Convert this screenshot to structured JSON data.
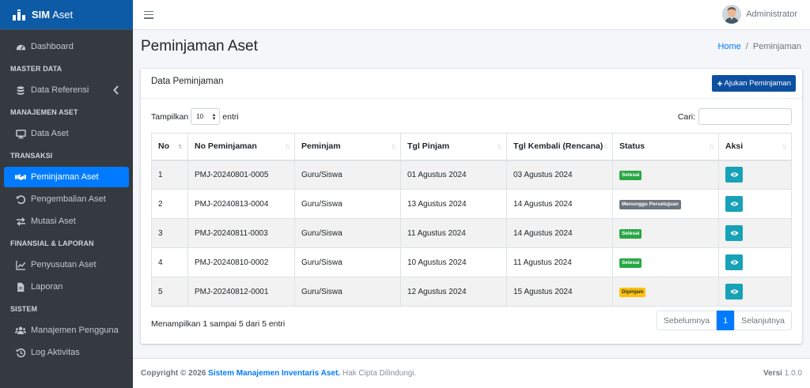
{
  "brand": {
    "name_bold": "SIM",
    "name_light": "Aset"
  },
  "topbar": {
    "user_name": "Administrator"
  },
  "sidebar": {
    "items": [
      {
        "type": "item",
        "label": "Dashboard",
        "icon": "dashboard-icon"
      },
      {
        "type": "header",
        "label": "MASTER DATA"
      },
      {
        "type": "item",
        "label": "Data Referensi",
        "icon": "database-icon"
      },
      {
        "type": "header",
        "label": "MANAJEMEN ASET"
      },
      {
        "type": "item",
        "label": "Data Aset",
        "icon": "desktop-icon"
      },
      {
        "type": "header",
        "label": "TRANSAKSI"
      },
      {
        "type": "item",
        "label": "Peminjaman Aset",
        "icon": "handshake-icon",
        "active": true
      },
      {
        "type": "item",
        "label": "Pengembalian Aset",
        "icon": "undo-icon"
      },
      {
        "type": "item",
        "label": "Mutasi Aset",
        "icon": "exchange-icon"
      },
      {
        "type": "header",
        "label": "FINANSIAL & LAPORAN"
      },
      {
        "type": "item",
        "label": "Penyusutan Aset",
        "icon": "chart-line-icon"
      },
      {
        "type": "item",
        "label": "Laporan",
        "icon": "file-icon"
      },
      {
        "type": "header",
        "label": "SISTEM"
      },
      {
        "type": "item",
        "label": "Manajemen Pengguna",
        "icon": "users-icon"
      },
      {
        "type": "item",
        "label": "Log Aktivitas",
        "icon": "history-icon"
      }
    ]
  },
  "page": {
    "title": "Peminjaman Aset",
    "breadcrumb_home": "Home",
    "breadcrumb_sep": "/",
    "breadcrumb_current": "Peminjaman"
  },
  "card": {
    "title": "Data Peminjaman",
    "add_button": "Ajukan Peminjaman",
    "show_label": "Tampilkan",
    "show_value": "10",
    "entries_label": "entri",
    "search_label": "Cari:",
    "search_value": ""
  },
  "table": {
    "columns": [
      "No",
      "No Peminjaman",
      "Peminjam",
      "Tgl Pinjam",
      "Tgl Kembali (Rencana)",
      "Status",
      "Aksi"
    ],
    "rows": [
      {
        "no": "1",
        "kode": "PMJ-20240801-0005",
        "peminjam": "Guru/Siswa",
        "tgl_pinjam": "01 Agustus 2024",
        "tgl_kembali": "03 Agustus 2024",
        "status": "Selesai",
        "status_color": "#28a745"
      },
      {
        "no": "2",
        "kode": "PMJ-20240813-0004",
        "peminjam": "Guru/Siswa",
        "tgl_pinjam": "13 Agustus 2024",
        "tgl_kembali": "14 Agustus 2024",
        "status": "Menunggu Persetujuan",
        "status_color": "#6c757d"
      },
      {
        "no": "3",
        "kode": "PMJ-20240811-0003",
        "peminjam": "Guru/Siswa",
        "tgl_pinjam": "11 Agustus 2024",
        "tgl_kembali": "14 Agustus 2024",
        "status": "Selesai",
        "status_color": "#28a745"
      },
      {
        "no": "4",
        "kode": "PMJ-20240810-0002",
        "peminjam": "Guru/Siswa",
        "tgl_pinjam": "10 Agustus 2024",
        "tgl_kembali": "11 Agustus 2024",
        "status": "Selesai",
        "status_color": "#28a745"
      },
      {
        "no": "5",
        "kode": "PMJ-20240812-0001",
        "peminjam": "Guru/Siswa",
        "tgl_pinjam": "12 Agustus 2024",
        "tgl_kembali": "15 Agustus 2024",
        "status": "Dipinjam",
        "status_color": "#ffc107"
      }
    ]
  },
  "pagination": {
    "info": "Menampilkan 1 sampai 5 dari 5 entri",
    "prev": "Sebelumnya",
    "current": "1",
    "next": "Selanjutnya"
  },
  "footer": {
    "copyright_prefix": "Copyright © 2026",
    "app_name": "Sistem Manajemen Inventaris Aset.",
    "rights": "Hak Cipta Dilindungi.",
    "version_label": "Versi",
    "version_value": "1.0.0"
  },
  "colors": {
    "primary": "#007bff",
    "brand": "#0d5aa7",
    "sidebar": "#343a40",
    "info": "#17a2b8"
  }
}
